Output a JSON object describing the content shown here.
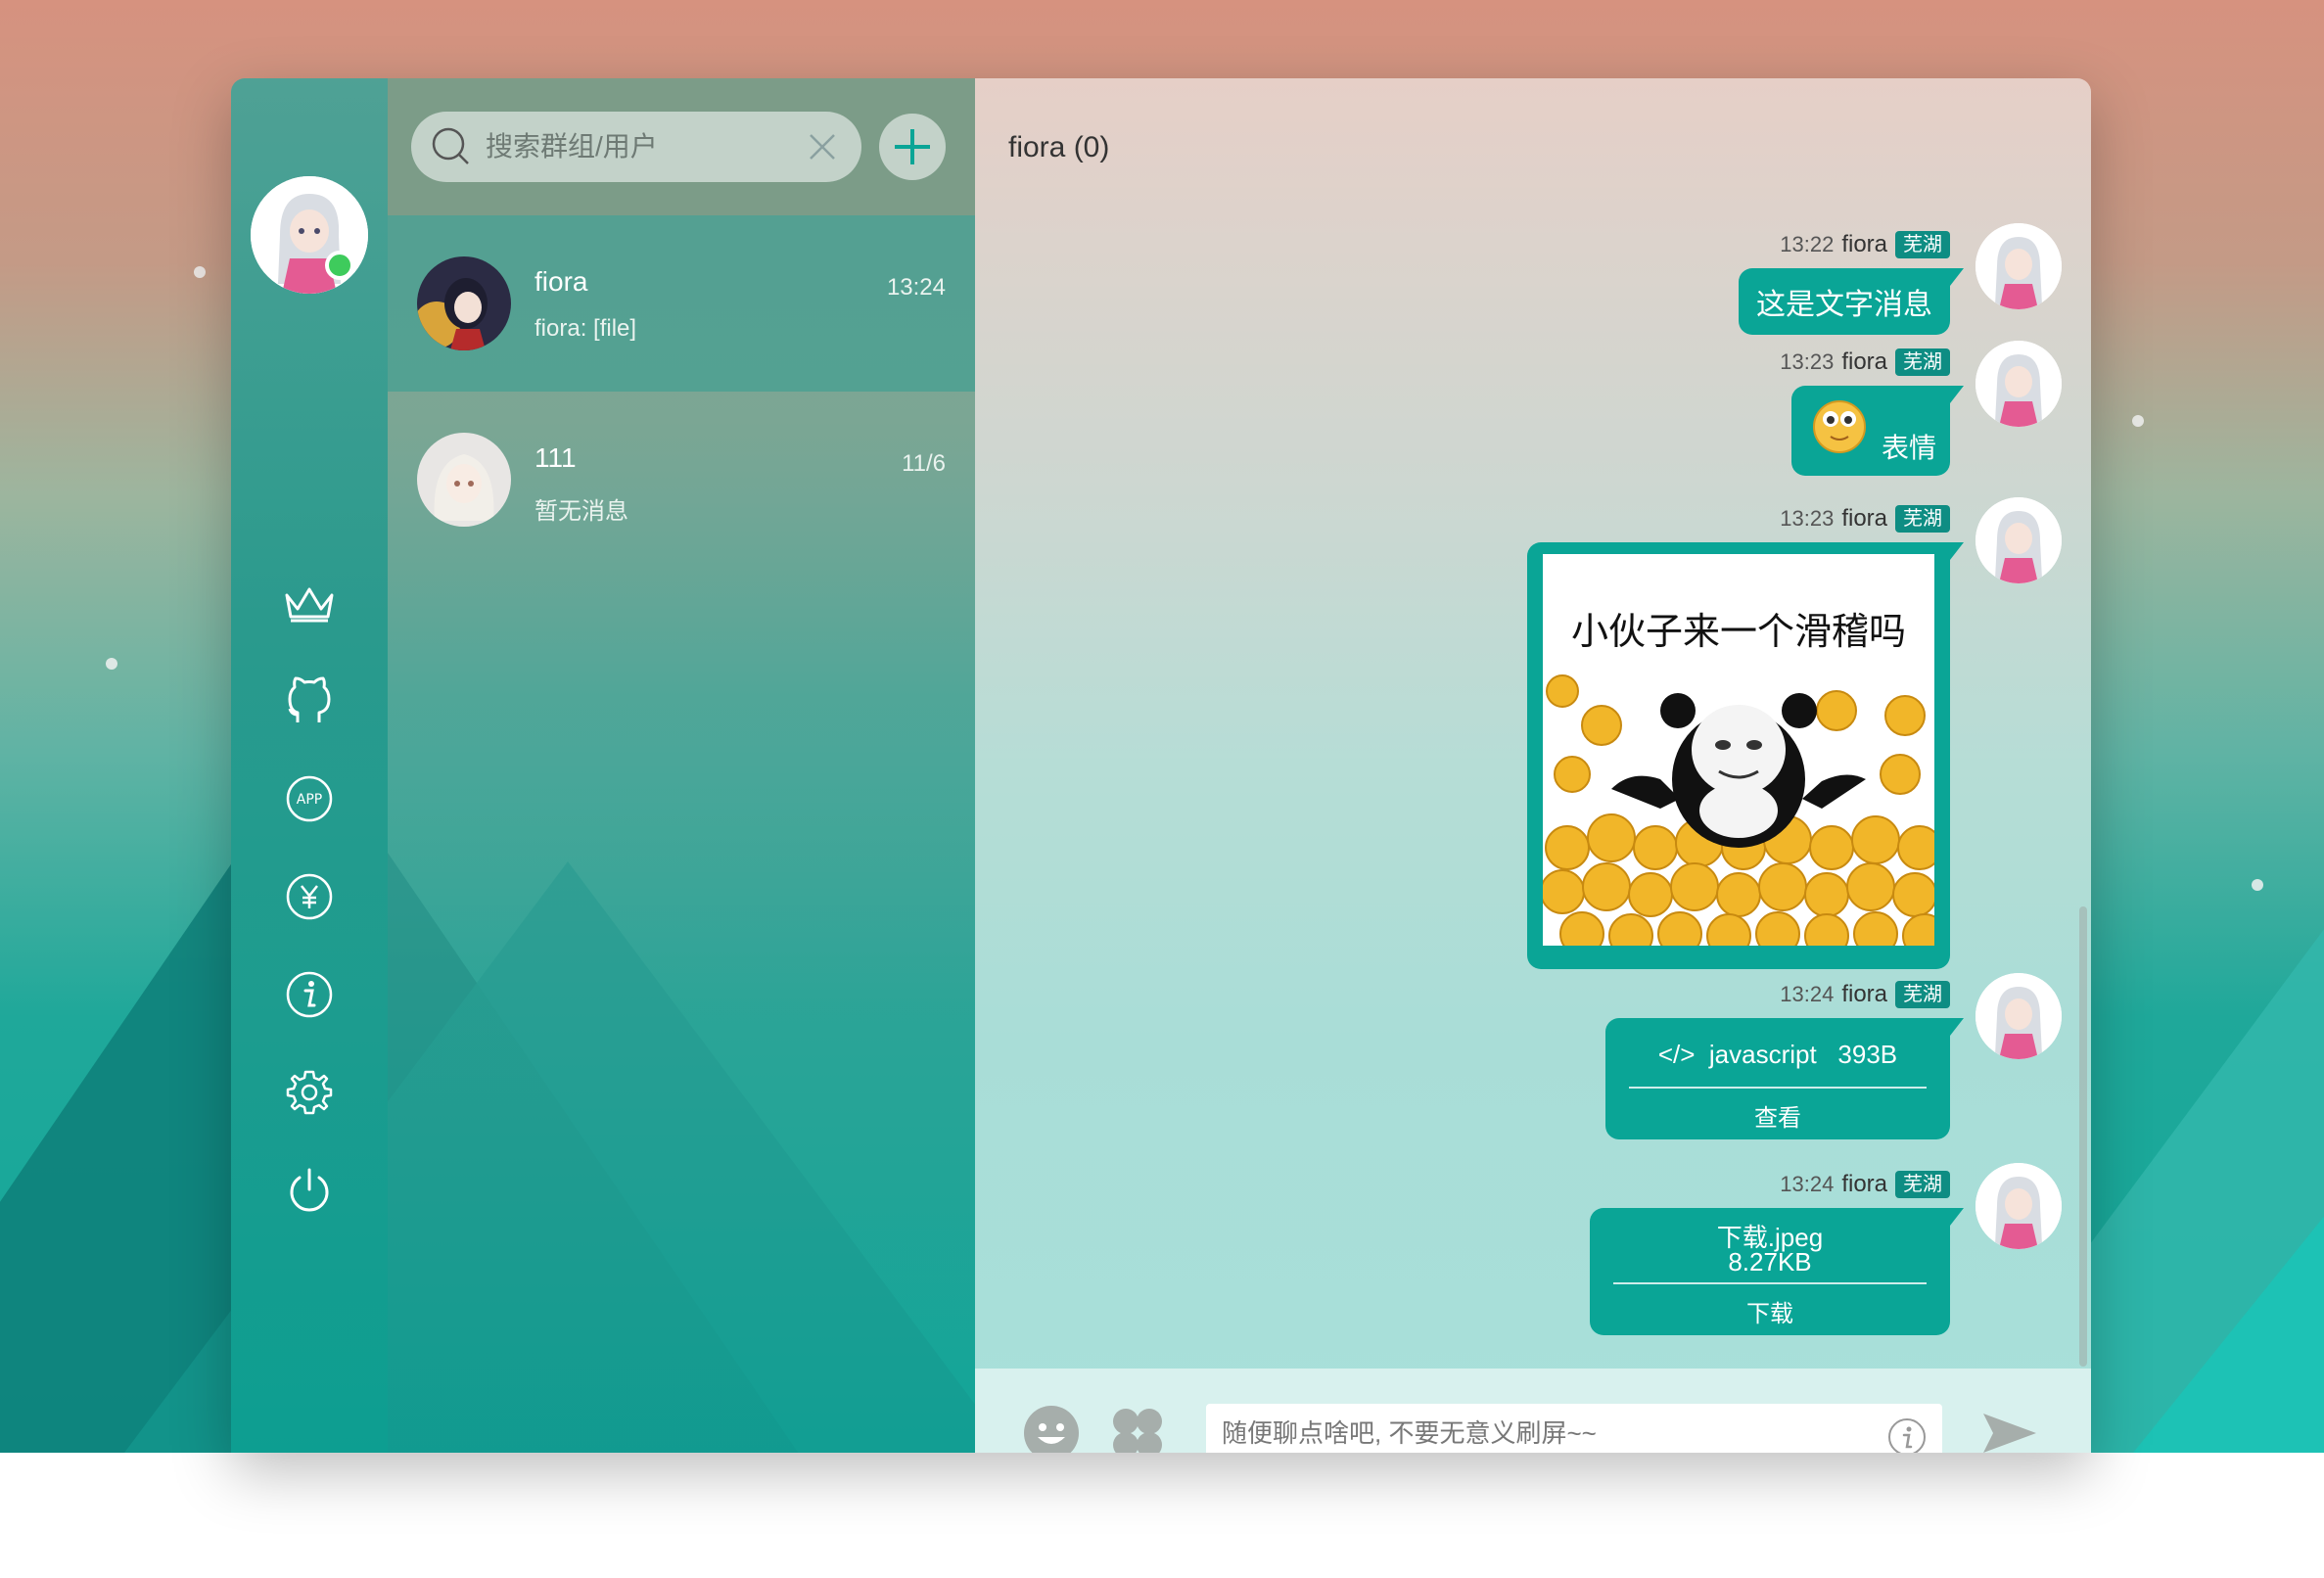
{
  "search": {
    "placeholder": "搜索群组/用户"
  },
  "conversations": [
    {
      "name": "fiora",
      "time": "13:24",
      "preview": "fiora: [file]"
    },
    {
      "name": "111",
      "time": "11/6",
      "preview": "暂无消息"
    }
  ],
  "chat": {
    "title": "fiora (0)"
  },
  "messages": [
    {
      "time": "13:22",
      "name": "fiora",
      "tag": "芜湖",
      "text": "这是文字消息"
    },
    {
      "time": "13:23",
      "name": "fiora",
      "tag": "芜湖",
      "text": "表情"
    },
    {
      "time": "13:23",
      "name": "fiora",
      "tag": "芜湖",
      "image_caption": "小伙子来一个滑稽吗"
    },
    {
      "time": "13:24",
      "name": "fiora",
      "tag": "芜湖",
      "code_lang": "javascript",
      "code_size": "393B",
      "action": "查看"
    },
    {
      "time": "13:24",
      "name": "fiora",
      "tag": "芜湖",
      "file_name": "下载.jpeg",
      "file_size": "8.27KB",
      "action": "下载"
    }
  ],
  "input": {
    "placeholder": "随便聊点啥吧, 不要无意义刷屏~~"
  },
  "icons": {
    "rail": [
      "crown-icon",
      "github-icon",
      "app-icon",
      "yuan-icon",
      "info-icon",
      "gear-icon",
      "power-icon"
    ],
    "header": [
      "share-icon",
      "group-panel-icon"
    ],
    "input": [
      "emoji-icon",
      "clover-icon",
      "info-icon",
      "send-icon"
    ]
  },
  "colors": {
    "accent": "#0aa596",
    "tag_bg": "#0e8d83",
    "online": "#3ecb5c"
  }
}
